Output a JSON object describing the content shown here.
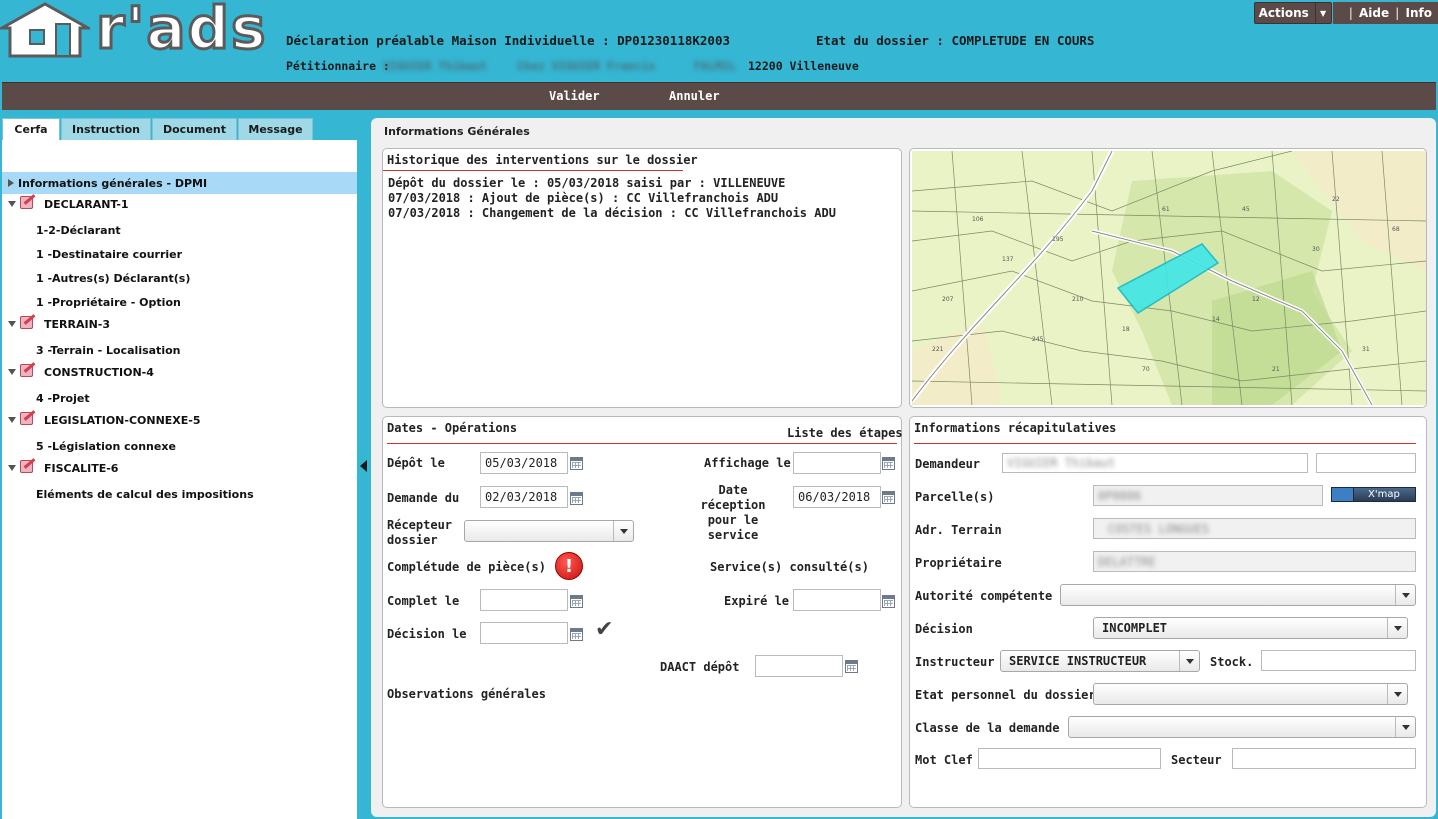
{
  "app": {
    "logo_text": "r'ads"
  },
  "header": {
    "title": "Déclaration préalable Maison Individuelle : DP01230118K2003",
    "status": "Etat du dossier : COMPLETUDE EN COURS",
    "petitioner_label": "Pétitionnaire :",
    "petitioner_name": "VIGUIER Thibaut",
    "petitioner_extra": "Chez VIGUIER Francis",
    "petitioner_place": "FALMIL",
    "petitioner_city": "12200 Villeneuve"
  },
  "top_links": {
    "actions": "Actions",
    "aide": "Aide",
    "info": "Info",
    "sep": "|"
  },
  "toolbar": {
    "valider": "Valider",
    "annuler": "Annuler"
  },
  "tabs": [
    "Cerfa",
    "Instruction",
    "Document",
    "Message"
  ],
  "tree": [
    {
      "label": "Informations générales - DPMI",
      "level": 0,
      "type": "leaf",
      "selected": true
    },
    {
      "label": "DECLARANT-1",
      "level": 0,
      "type": "folder"
    },
    {
      "label": "1-2-Déclarant",
      "level": 1
    },
    {
      "label": "1 -Destinataire courrier",
      "level": 1
    },
    {
      "label": "1 -Autres(s) Déclarant(s)",
      "level": 1
    },
    {
      "label": "1 -Propriétaire - Option",
      "level": 1
    },
    {
      "label": "TERRAIN-3",
      "level": 0,
      "type": "folder"
    },
    {
      "label": "3 -Terrain - Localisation",
      "level": 1
    },
    {
      "label": "CONSTRUCTION-4",
      "level": 0,
      "type": "folder"
    },
    {
      "label": "4 -Projet",
      "level": 1
    },
    {
      "label": "LEGISLATION-CONNEXE-5",
      "level": 0,
      "type": "folder"
    },
    {
      "label": "5 -Législation connexe",
      "level": 1
    },
    {
      "label": "FISCALITE-6",
      "level": 0,
      "type": "folder"
    },
    {
      "label": "Eléments de calcul des impositions",
      "level": 1
    }
  ],
  "content": {
    "title": "Informations Générales",
    "history": {
      "title": "Historique des interventions sur le dossier",
      "lines": [
        "Dépôt du dossier le : 05/03/2018 saisi par : VILLENEUVE",
        "07/03/2018 : Ajout de pièce(s) : CC Villefranchois ADU",
        "07/03/2018 : Changement de la décision : CC Villefranchois ADU"
      ]
    },
    "dates": {
      "title": "Dates - Opérations",
      "steps_link": "Liste des étapes",
      "depot_label": "Dépôt le",
      "depot_value": "05/03/2018",
      "demande_label": "Demande du",
      "demande_value": "02/03/2018",
      "recepteur_label": "Récepteur dossier",
      "recepteur_value": "",
      "completude_label": "Complétude de pièce(s)",
      "complet_label": "Complet le",
      "complet_value": "",
      "decision_label": "Décision le",
      "decision_value": "",
      "affichage_label": "Affichage le",
      "affichage_value": "",
      "reception_label": "Date réception pour le service",
      "reception_value": "06/03/2018",
      "services_label": "Service(s) consulté(s)",
      "expire_label": "Expiré le",
      "expire_value": "",
      "daact_label": "DAACT dépôt",
      "daact_value": "",
      "observations_label": "Observations générales"
    },
    "recap": {
      "title": "Informations récapitulatives",
      "demandeur_label": "Demandeur",
      "demandeur_value": "VIGUIER Thibaut",
      "parcelle_label": "Parcelle(s)",
      "parcelle_value": "0P0006",
      "xmap_label": "X'map",
      "adr_label": "Adr. Terrain",
      "adr_value": "COSTES LONGUES",
      "proprietaire_label": "Propriétaire",
      "proprietaire_value": "DELATTRE",
      "autorite_label": "Autorité compétente",
      "autorite_value": "",
      "decision_label": "Décision",
      "decision_value": "INCOMPLET",
      "instructeur_label": "Instructeur",
      "instructeur_value": "SERVICE INSTRUCTEUR",
      "stock_label": "Stock.",
      "stock_value": "",
      "etat_label": "Etat personnel du dossier",
      "etat_value": "",
      "classe_label": "Classe de la demande",
      "classe_value": "",
      "motclef_label": "Mot Clef",
      "motclef_value": "",
      "secteur_label": "Secteur",
      "secteur_value": ""
    }
  },
  "colors": {
    "header_bg": "#35b6d3",
    "toolbar_bg": "#5b4a47",
    "accent_line": "#d0332e",
    "selection": "#a8daf7",
    "parcel_highlight": "#3fe6e6"
  }
}
